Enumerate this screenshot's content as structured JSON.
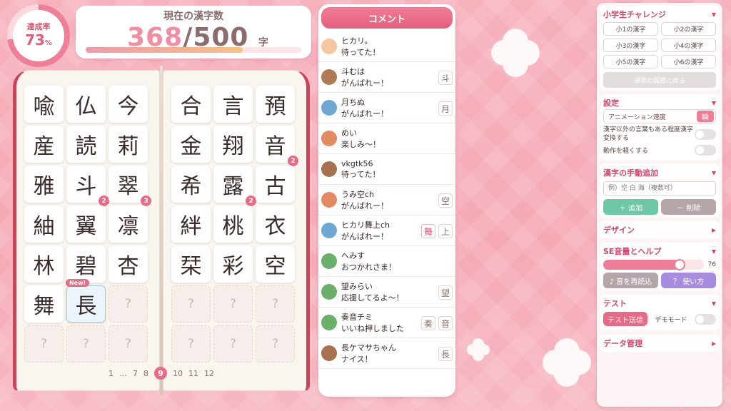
{
  "progress": {
    "label": "達成率",
    "value": "73",
    "unit": "%",
    "fraction": 0.736
  },
  "counter": {
    "title": "現在の漢字数",
    "current": "368",
    "separator": "/",
    "total": "500",
    "unit": "字"
  },
  "book": {
    "left": [
      {
        "k": "喩"
      },
      {
        "k": "仏"
      },
      {
        "k": "今"
      },
      {
        "k": "産"
      },
      {
        "k": "読"
      },
      {
        "k": "莉"
      },
      {
        "k": "雅"
      },
      {
        "k": "斗",
        "badge": "2"
      },
      {
        "k": "翠",
        "badge": "3"
      },
      {
        "k": "紬"
      },
      {
        "k": "翼"
      },
      {
        "k": "凛"
      },
      {
        "k": "林"
      },
      {
        "k": "碧"
      },
      {
        "k": "杏"
      },
      {
        "k": "舞"
      },
      {
        "k": "長",
        "new": "New!"
      },
      {
        "k": "?"
      },
      {
        "k": "?"
      },
      {
        "k": "?"
      },
      {
        "k": "?"
      }
    ],
    "right": [
      {
        "k": "合"
      },
      {
        "k": "言"
      },
      {
        "k": "預"
      },
      {
        "k": "金"
      },
      {
        "k": "翔"
      },
      {
        "k": "音",
        "badge": "2"
      },
      {
        "k": "希"
      },
      {
        "k": "露",
        "badge": "2"
      },
      {
        "k": "古"
      },
      {
        "k": "絆"
      },
      {
        "k": "桃"
      },
      {
        "k": "衣"
      },
      {
        "k": "栞"
      },
      {
        "k": "彩"
      },
      {
        "k": "空"
      },
      {
        "k": "?"
      },
      {
        "k": "?"
      },
      {
        "k": "?"
      },
      {
        "k": "?"
      },
      {
        "k": "?"
      },
      {
        "k": "?"
      }
    ],
    "pager": [
      "1",
      "…",
      "7",
      "8",
      "9",
      "10",
      "11",
      "12"
    ],
    "current_page": "9"
  },
  "comments": {
    "header": "コメント",
    "items": [
      {
        "name": "ヒカリ。",
        "text": "待ってた！",
        "avatar": "#f4c7a2",
        "kanji": []
      },
      {
        "name": "斗むは",
        "text": "がんばれー！",
        "avatar": "#b07a55",
        "kanji": [
          "斗"
        ]
      },
      {
        "name": "月ちぬ",
        "text": "がんばれー！",
        "avatar": "#6fa7d3",
        "kanji": [
          "月"
        ]
      },
      {
        "name": "めい",
        "text": "楽しみ〜！",
        "avatar": "#e38a63",
        "kanji": []
      },
      {
        "name": "vkgtk56",
        "text": "待ってた！",
        "avatar": "#a7704f",
        "kanji": []
      },
      {
        "name": "うみ空ch",
        "text": "がんばれー！",
        "avatar": "#e38a63",
        "kanji": [
          "空"
        ]
      },
      {
        "name": "ヒカリ舞上ch",
        "text": "がんばれー！",
        "avatar": "#6fa7d3",
        "kanji": [
          "舞",
          "上"
        ]
      },
      {
        "name": "へみす",
        "text": "おつかれさま！",
        "avatar": "#6ab06a",
        "kanji": []
      },
      {
        "name": "望みらい",
        "text": "応援してるよ〜！",
        "avatar": "#6ab06a",
        "kanji": [
          "望"
        ]
      },
      {
        "name": "奏音チミ",
        "text": "いいね押しました",
        "avatar": "#6ab06a",
        "kanji": [
          "奏",
          "音"
        ]
      },
      {
        "name": "長ケマサちゃん",
        "text": "ナイス！",
        "avatar": "#a7704f",
        "kanji": [
          "長"
        ]
      }
    ]
  },
  "panel": {
    "challenge": {
      "title": "小学生チャレンジ",
      "buttons": [
        "小1の漢字",
        "小2の漢字",
        "小3の漢字",
        "小4の漢字",
        "小5の漢字",
        "小6の漢字"
      ],
      "back": "通常の図鑑に戻る"
    },
    "settings": {
      "title": "設定",
      "anim_label": "アニメーション速度",
      "anim_value": "瞬",
      "convert_label": "漢字以外の言葉もある程度漢字変換する",
      "light_label": "動作を軽くする"
    },
    "manual": {
      "title": "漢字の手動追加",
      "placeholder": "例）空 白 海（複数可）",
      "add": "＋ 追加",
      "remove": "－ 削除"
    },
    "design": {
      "title": "デザイン"
    },
    "se": {
      "title": "SE音量とヘルプ",
      "volume": "76",
      "volume_fraction": 0.76,
      "reread": "♪ 音を再読込",
      "help": "？ 使い方"
    },
    "test": {
      "title": "テスト",
      "send": "テスト送信",
      "demo": "デモモード"
    },
    "data": {
      "title": "データ管理"
    }
  }
}
